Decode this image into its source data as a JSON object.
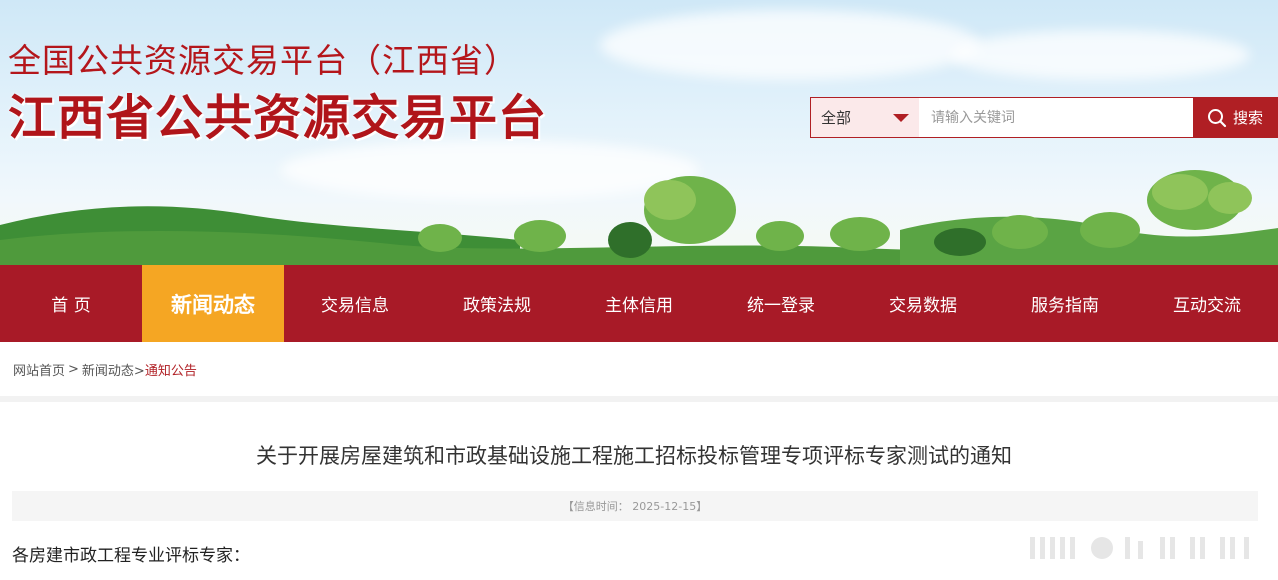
{
  "header": {
    "title_line1": "全国公共资源交易平台（江西省）",
    "title_line2": "江西省公共资源交易平台",
    "brand_color": "#b0151a"
  },
  "search": {
    "category_selected": "全部",
    "placeholder": "请输入关键词",
    "button_label": "搜索",
    "search_icon": "search-icon"
  },
  "nav": {
    "items": [
      {
        "label": "首 页"
      },
      {
        "label": "新闻动态"
      },
      {
        "label": "交易信息"
      },
      {
        "label": "政策法规"
      },
      {
        "label": "主体信用"
      },
      {
        "label": "统一登录"
      },
      {
        "label": "交易数据"
      },
      {
        "label": "服务指南"
      },
      {
        "label": "互动交流"
      }
    ],
    "active_index": 1,
    "bg_color": "#a81a27",
    "active_color": "#f5a623"
  },
  "breadcrumb": {
    "home": "网站首页",
    "sep": ">",
    "section": "新闻动态>",
    "current": "通知公告"
  },
  "article": {
    "title": "关于开展房屋建筑和市政基础设施工程施工招标投标管理专项评标专家测试的通知",
    "meta": "【信息时间： 2025-12-15】",
    "greeting": "各房建市政工程专业评标专家："
  }
}
